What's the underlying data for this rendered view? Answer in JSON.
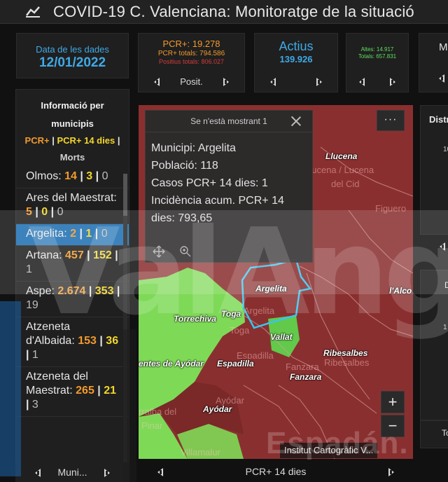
{
  "header": {
    "title": "COVID-19 C. Valenciana: Monitoratge de la situació"
  },
  "date_panel": {
    "label": "Data de les dades",
    "value": "12/01/2022"
  },
  "pcr_panel": {
    "main": "PCR+: 19.278",
    "total": "PCR+ totals: 794.586",
    "positius": "Positius totals: 806.027",
    "nav_label": "Posit."
  },
  "actius_panel": {
    "label": "Actius",
    "value": "139.926"
  },
  "altes_panel": {
    "altes": "Altes: 14.917",
    "totals": "Totals: 657.831"
  },
  "m_panel": {
    "letter": "M"
  },
  "list": {
    "title": "Informació per municipis",
    "sub_pcr": "PCR+",
    "sub_sep1": " | ",
    "sub_pcr14": "PCR+ 14 dies",
    "sub_sep2": " |",
    "sub_morts": "Morts",
    "items": [
      {
        "name": "Olmos: ",
        "pcr": "14",
        "pcr14": "3",
        "morts": "0"
      },
      {
        "name": "Ares del Maestrat: ",
        "pcr": "5",
        "pcr14": "0",
        "morts": "0"
      },
      {
        "name": "Argelita: ",
        "pcr": "2",
        "pcr14": "1",
        "morts": "0"
      },
      {
        "name": "Artana: ",
        "pcr": "457",
        "pcr14": "152",
        "morts": "1"
      },
      {
        "name": "Aspe: ",
        "pcr": "2.674",
        "pcr14": "353",
        "morts": "19"
      },
      {
        "name": "Atzeneta d'Albaida: ",
        "pcr": "153",
        "pcr14": "36",
        "morts": "1"
      },
      {
        "name": "Atzeneta del Maestrat: ",
        "pcr": "265",
        "pcr14": "21",
        "morts": "3"
      }
    ],
    "sep": " | ",
    "nav_label": "Muni..."
  },
  "popup": {
    "header": "Se n'està mostrant 1",
    "municipi": "Municipi: Argelita",
    "poblacio": "Població: 118",
    "casos": "Casos PCR+ 14 dies: 1",
    "incidencia": "Incidència acum. PCR+ 14 dies: 793,65"
  },
  "map": {
    "labels": [
      "Llucena",
      "Argelita",
      "Toga",
      "Torrechiva",
      "Vallat",
      "Ribesalbes",
      "Espadilla",
      "entes de Ayódar",
      "Fanzara",
      "Ayódar",
      "l'Alco"
    ],
    "ghost_labels": [
      "Lucena / Lucena",
      "del Cid",
      "Figuero",
      "Argelita",
      "Toga",
      "Espadilla",
      "Fanzara",
      "Ribesalbes",
      "Ayódar",
      "Villamalur",
      "rralba del",
      "Pinar"
    ],
    "zoom_in": "+",
    "zoom_out": "−",
    "more": "···",
    "attribution": "Institut Cartogràfic V...",
    "nav_label": "PCR+ 14 dies",
    "colors": {
      "high": "#8a2f2f",
      "low": "#7ed957",
      "selected": "#36c5f0"
    }
  },
  "right": {
    "distr": "Distr",
    "n1": "10",
    "d": "D",
    "n2": "1",
    "tx": "To"
  },
  "watermark": {
    "text": "ValAng",
    "sub": "Espadán."
  }
}
